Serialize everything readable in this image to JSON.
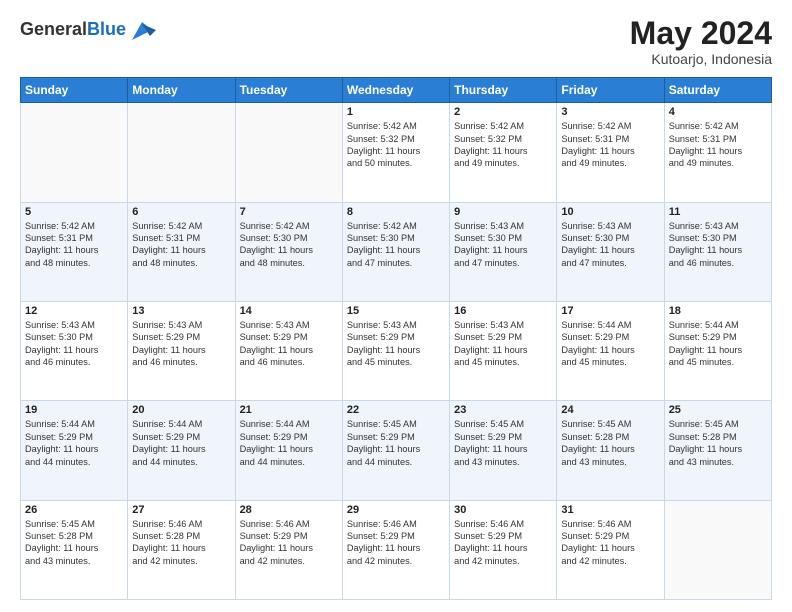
{
  "header": {
    "logo_line1": "General",
    "logo_line2": "Blue",
    "month_year": "May 2024",
    "location": "Kutoarjo, Indonesia"
  },
  "weekdays": [
    "Sunday",
    "Monday",
    "Tuesday",
    "Wednesday",
    "Thursday",
    "Friday",
    "Saturday"
  ],
  "weeks": [
    [
      {
        "day": "",
        "text": ""
      },
      {
        "day": "",
        "text": ""
      },
      {
        "day": "",
        "text": ""
      },
      {
        "day": "1",
        "text": "Sunrise: 5:42 AM\nSunset: 5:32 PM\nDaylight: 11 hours\nand 50 minutes."
      },
      {
        "day": "2",
        "text": "Sunrise: 5:42 AM\nSunset: 5:32 PM\nDaylight: 11 hours\nand 49 minutes."
      },
      {
        "day": "3",
        "text": "Sunrise: 5:42 AM\nSunset: 5:31 PM\nDaylight: 11 hours\nand 49 minutes."
      },
      {
        "day": "4",
        "text": "Sunrise: 5:42 AM\nSunset: 5:31 PM\nDaylight: 11 hours\nand 49 minutes."
      }
    ],
    [
      {
        "day": "5",
        "text": "Sunrise: 5:42 AM\nSunset: 5:31 PM\nDaylight: 11 hours\nand 48 minutes."
      },
      {
        "day": "6",
        "text": "Sunrise: 5:42 AM\nSunset: 5:31 PM\nDaylight: 11 hours\nand 48 minutes."
      },
      {
        "day": "7",
        "text": "Sunrise: 5:42 AM\nSunset: 5:30 PM\nDaylight: 11 hours\nand 48 minutes."
      },
      {
        "day": "8",
        "text": "Sunrise: 5:42 AM\nSunset: 5:30 PM\nDaylight: 11 hours\nand 47 minutes."
      },
      {
        "day": "9",
        "text": "Sunrise: 5:43 AM\nSunset: 5:30 PM\nDaylight: 11 hours\nand 47 minutes."
      },
      {
        "day": "10",
        "text": "Sunrise: 5:43 AM\nSunset: 5:30 PM\nDaylight: 11 hours\nand 47 minutes."
      },
      {
        "day": "11",
        "text": "Sunrise: 5:43 AM\nSunset: 5:30 PM\nDaylight: 11 hours\nand 46 minutes."
      }
    ],
    [
      {
        "day": "12",
        "text": "Sunrise: 5:43 AM\nSunset: 5:30 PM\nDaylight: 11 hours\nand 46 minutes."
      },
      {
        "day": "13",
        "text": "Sunrise: 5:43 AM\nSunset: 5:29 PM\nDaylight: 11 hours\nand 46 minutes."
      },
      {
        "day": "14",
        "text": "Sunrise: 5:43 AM\nSunset: 5:29 PM\nDaylight: 11 hours\nand 46 minutes."
      },
      {
        "day": "15",
        "text": "Sunrise: 5:43 AM\nSunset: 5:29 PM\nDaylight: 11 hours\nand 45 minutes."
      },
      {
        "day": "16",
        "text": "Sunrise: 5:43 AM\nSunset: 5:29 PM\nDaylight: 11 hours\nand 45 minutes."
      },
      {
        "day": "17",
        "text": "Sunrise: 5:44 AM\nSunset: 5:29 PM\nDaylight: 11 hours\nand 45 minutes."
      },
      {
        "day": "18",
        "text": "Sunrise: 5:44 AM\nSunset: 5:29 PM\nDaylight: 11 hours\nand 45 minutes."
      }
    ],
    [
      {
        "day": "19",
        "text": "Sunrise: 5:44 AM\nSunset: 5:29 PM\nDaylight: 11 hours\nand 44 minutes."
      },
      {
        "day": "20",
        "text": "Sunrise: 5:44 AM\nSunset: 5:29 PM\nDaylight: 11 hours\nand 44 minutes."
      },
      {
        "day": "21",
        "text": "Sunrise: 5:44 AM\nSunset: 5:29 PM\nDaylight: 11 hours\nand 44 minutes."
      },
      {
        "day": "22",
        "text": "Sunrise: 5:45 AM\nSunset: 5:29 PM\nDaylight: 11 hours\nand 44 minutes."
      },
      {
        "day": "23",
        "text": "Sunrise: 5:45 AM\nSunset: 5:29 PM\nDaylight: 11 hours\nand 43 minutes."
      },
      {
        "day": "24",
        "text": "Sunrise: 5:45 AM\nSunset: 5:28 PM\nDaylight: 11 hours\nand 43 minutes."
      },
      {
        "day": "25",
        "text": "Sunrise: 5:45 AM\nSunset: 5:28 PM\nDaylight: 11 hours\nand 43 minutes."
      }
    ],
    [
      {
        "day": "26",
        "text": "Sunrise: 5:45 AM\nSunset: 5:28 PM\nDaylight: 11 hours\nand 43 minutes."
      },
      {
        "day": "27",
        "text": "Sunrise: 5:46 AM\nSunset: 5:28 PM\nDaylight: 11 hours\nand 42 minutes."
      },
      {
        "day": "28",
        "text": "Sunrise: 5:46 AM\nSunset: 5:29 PM\nDaylight: 11 hours\nand 42 minutes."
      },
      {
        "day": "29",
        "text": "Sunrise: 5:46 AM\nSunset: 5:29 PM\nDaylight: 11 hours\nand 42 minutes."
      },
      {
        "day": "30",
        "text": "Sunrise: 5:46 AM\nSunset: 5:29 PM\nDaylight: 11 hours\nand 42 minutes."
      },
      {
        "day": "31",
        "text": "Sunrise: 5:46 AM\nSunset: 5:29 PM\nDaylight: 11 hours\nand 42 minutes."
      },
      {
        "day": "",
        "text": ""
      }
    ]
  ]
}
